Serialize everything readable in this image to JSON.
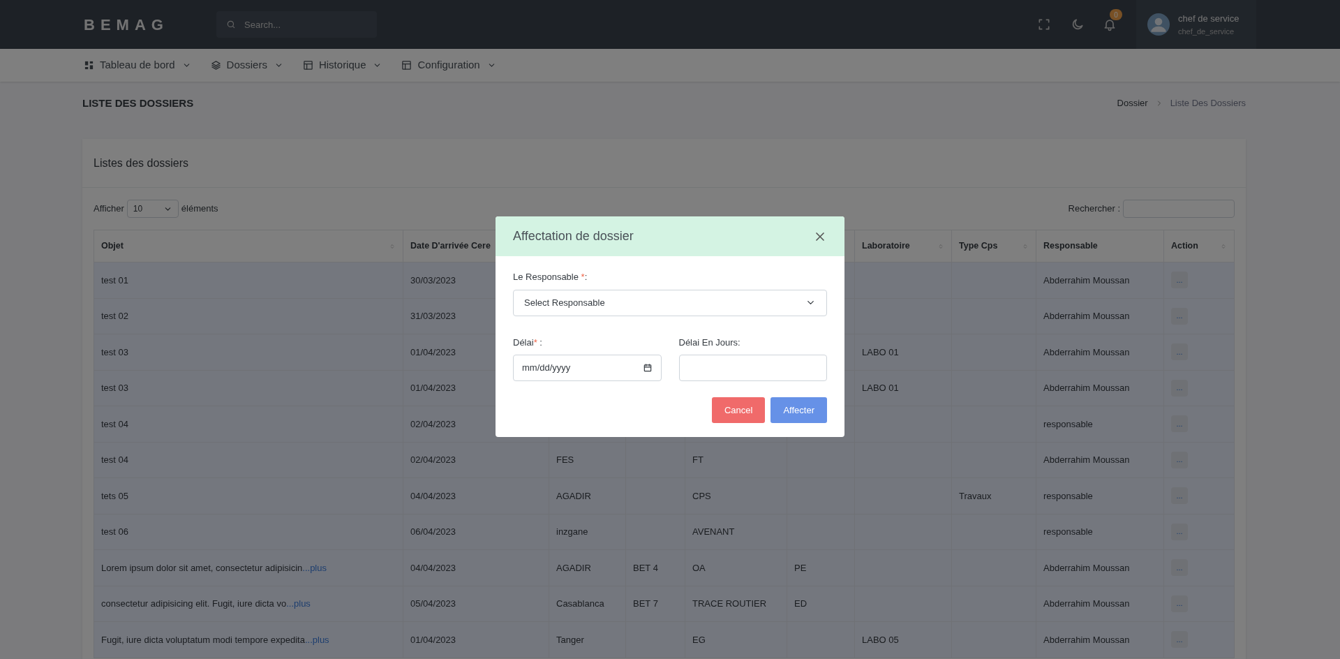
{
  "topbar": {
    "logo": "BEMAG",
    "search_placeholder": "Search...",
    "notification_count": "0",
    "user": {
      "name": "chef de service",
      "username": "chef_de_service"
    }
  },
  "nav": [
    {
      "label": "Tableau de bord",
      "kind": "dashboard"
    },
    {
      "label": "Dossiers",
      "kind": "layers"
    },
    {
      "label": "Historique",
      "kind": "layout"
    },
    {
      "label": "Configuration",
      "kind": "layout"
    }
  ],
  "page_title": "LISTE DES DOSSIERS",
  "breadcrumb": [
    {
      "label": "Dossier",
      "current": false
    },
    {
      "label": "Liste Des Dossiers",
      "current": true
    }
  ],
  "card": {
    "title": "Listes des dossiers",
    "show_before": "Afficher",
    "show_value": "10",
    "show_after": "éléments",
    "search_label": "Rechercher :"
  },
  "table": {
    "columns": [
      {
        "label": "Objet",
        "sortable": true
      },
      {
        "label": "Date D'arrivée Cere"
      },
      {},
      {},
      {},
      {},
      {
        "label": "Laboratoire",
        "sortable": true
      },
      {
        "label": "Type Cps",
        "sortable": true
      },
      {
        "label": "Responsable",
        "sortable": false
      },
      {
        "label": "Action",
        "sortable": true
      }
    ],
    "rows": [
      {
        "objet": "test 01",
        "date": "30/03/2023",
        "responsable": "Abderrahim Moussan",
        "action": "..."
      },
      {
        "objet": "test 02",
        "date": "31/03/2023",
        "responsable": "Abderrahim Moussan",
        "action": "..."
      },
      {
        "objet": "test 03",
        "date": "01/04/2023",
        "laboratoire": "LABO 01",
        "responsable": "Abderrahim Moussan",
        "action": "..."
      },
      {
        "objet": "test 03",
        "date": "01/04/2023",
        "laboratoire": "LABO 01",
        "responsable": "Abderrahim Moussan",
        "action": "..."
      },
      {
        "objet": "test 04",
        "date": "02/04/2023",
        "responsable": "responsable",
        "action": "..."
      },
      {
        "objet": "test 04",
        "date": "02/04/2023",
        "column_3": "FES",
        "column_5": "FT",
        "responsable": "Abderrahim Moussan",
        "action": "..."
      },
      {
        "objet": "tets 05",
        "date": "04/04/2023",
        "column_3": "AGADIR",
        "column_5": "CPS",
        "type_cps": "Travaux",
        "responsable": "responsable",
        "action": "..."
      },
      {
        "objet": "test 06",
        "date": "06/04/2023",
        "column_3": "inzgane",
        "column_5": "AVENANT",
        "responsable": "responsable",
        "action": "..."
      },
      {
        "objet": "Lorem ipsum dolor sit amet, consectetur adipisicin",
        "more": "...plus",
        "date": "04/04/2023",
        "column_3": "AGADIR",
        "column_4": "BET 4",
        "column_5": "OA",
        "column_6": "PE",
        "responsable": "Abderrahim Moussan",
        "action": "..."
      },
      {
        "objet": "consectetur adipisicing elit. Fugit, iure dicta vo",
        "more": "...plus",
        "date": "05/04/2023",
        "column_3": "Casablanca",
        "column_4": "BET 7",
        "column_5": "TRACE ROUTIER",
        "column_6": "ED",
        "responsable": "Abderrahim Moussan",
        "action": "..."
      },
      {
        "objet": "Fugit, iure dicta voluptatum modi tempore expedita",
        "more": "...plus",
        "date": "01/04/2023",
        "column_3": "Tanger",
        "column_5": "EG",
        "laboratoire": "LABO 05",
        "responsable": "Abderrahim Moussan",
        "action": "..."
      }
    ]
  },
  "modal": {
    "title": "Affectation de dossier",
    "fields": [
      {
        "kind": "select",
        "label": "Le Responsable ",
        "required_mark": "*",
        "suffix": ":",
        "value": "Select Responsable"
      },
      {
        "kind": "date",
        "label": "Délai",
        "required_mark": "*",
        "suffix": " :",
        "placeholder": "mm/dd/yyyy"
      },
      {
        "kind": "text",
        "label": "Délai En Jours:"
      }
    ],
    "buttons": [
      {
        "label": "Cancel",
        "kind": "cancel"
      },
      {
        "label": "Affecter",
        "kind": "primary"
      }
    ]
  }
}
